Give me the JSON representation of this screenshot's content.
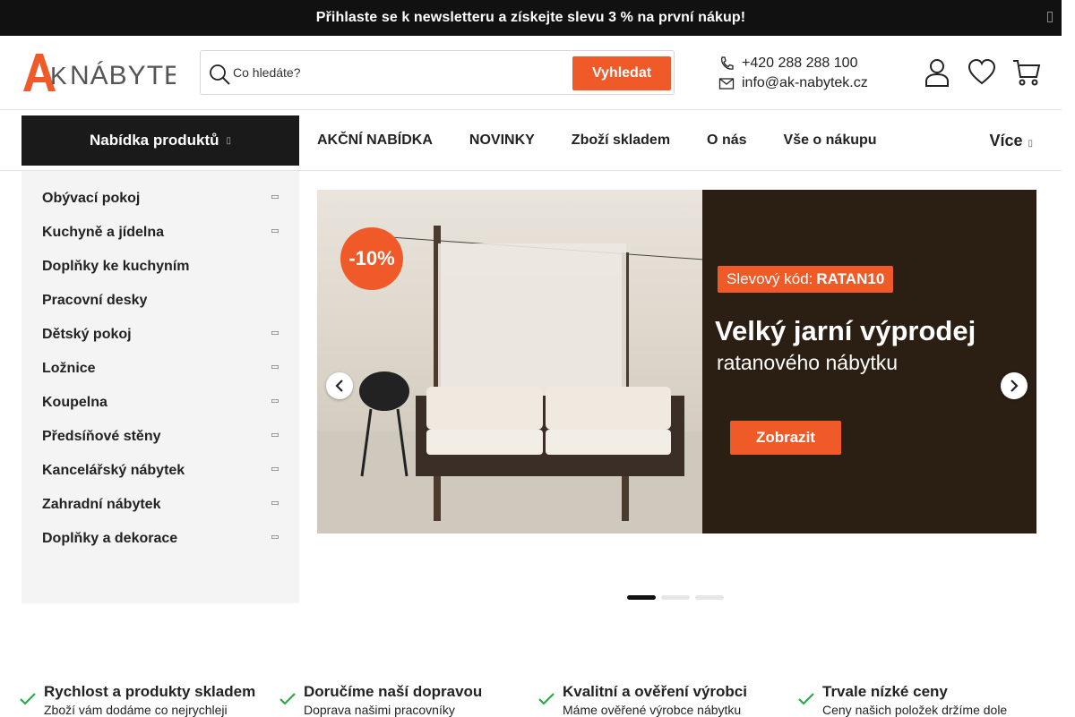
{
  "topbar": {
    "message": "Přihlaste se k newsletteru a získejte slevu 3 % na první nákup!"
  },
  "header": {
    "logo_text": "AK NÁBYTEK",
    "search_placeholder": "Co hledáte?",
    "search_button": "Vyhledat",
    "phone": "+420 288 288 100",
    "email": "info@ak-nabytek.cz",
    "icons": [
      "user-icon",
      "heart-icon",
      "cart-icon"
    ]
  },
  "nav": {
    "products_button": "Nabídka produktů",
    "links": [
      "AKČNÍ NABÍDKA",
      "NOVINKY",
      "Zboží skladem",
      "O nás",
      "Vše o nákupu"
    ],
    "more": "Více"
  },
  "sidebar": {
    "items": [
      {
        "label": "Obývací pokoj",
        "has_sub": true
      },
      {
        "label": "Kuchyně a jídelna",
        "has_sub": true
      },
      {
        "label": "Doplňky ke kuchyním",
        "has_sub": false
      },
      {
        "label": "Pracovní desky",
        "has_sub": false
      },
      {
        "label": "Dětský pokoj",
        "has_sub": true
      },
      {
        "label": "Ložnice",
        "has_sub": true
      },
      {
        "label": "Koupelna",
        "has_sub": true
      },
      {
        "label": "Předsíňové stěny",
        "has_sub": true
      },
      {
        "label": "Kancelářský nábytek",
        "has_sub": true
      },
      {
        "label": "Zahradní nábytek",
        "has_sub": true
      },
      {
        "label": "Doplňky a dekorace",
        "has_sub": true
      }
    ]
  },
  "hero": {
    "badge": "-10%",
    "promo_label": "Slevový kód:",
    "promo_code": "RATAN10",
    "title": "Velký jarní výprodej",
    "subtitle": "ratanového nábytku",
    "cta": "Zobrazit",
    "slides_total": 3,
    "active_slide": 1
  },
  "usps": [
    {
      "title": "Rychlost a produkty skladem",
      "desc": "Zboží vám dodáme co nejrychleji"
    },
    {
      "title": "Doručíme naší dopravou",
      "desc": "Doprava našimi pracovníky"
    },
    {
      "title": "Kvalitní a ověření výrobci",
      "desc": "Máme ověřené výrobce nábytku"
    },
    {
      "title": "Trvale nízké ceny",
      "desc": "Ceny našich položek držíme dole"
    }
  ],
  "colors": {
    "accent": "#f05a28",
    "dark": "#111111",
    "sidebar_bg": "#f4f4f4",
    "check": "#2ba84a"
  }
}
